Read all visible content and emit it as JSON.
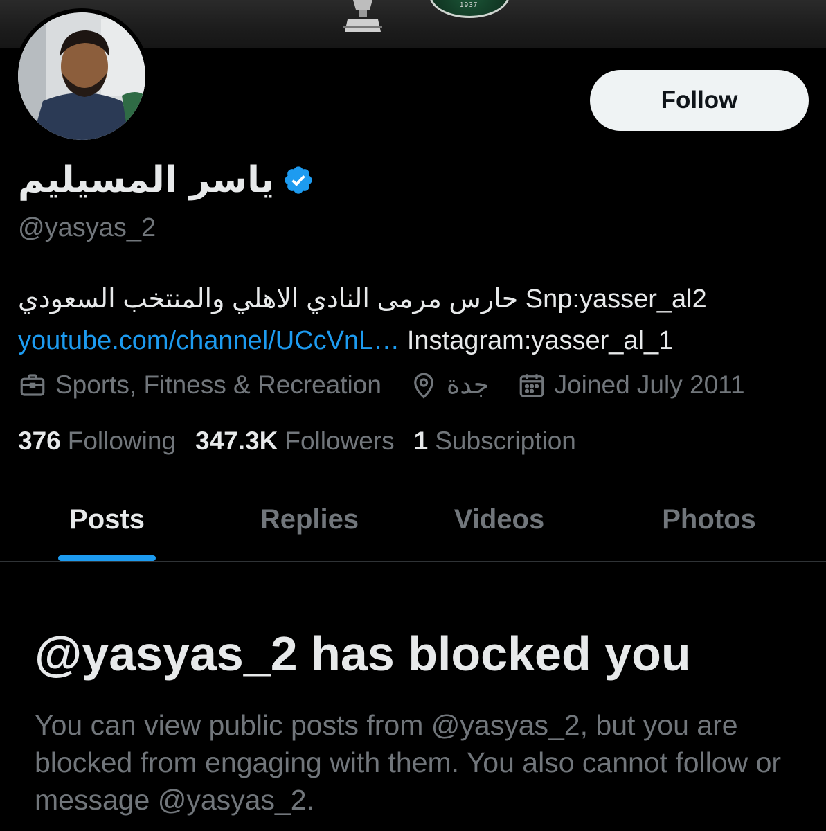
{
  "profile": {
    "display_name": "ياسر المسيليم",
    "handle": "@yasyas_2",
    "verified": true,
    "follow_label": "Follow",
    "bio_line1": "حارس مرمى النادي الاهلي والمنتخب السعودي Snp:yasser_al2",
    "bio_link": "youtube.com/channel/UCcVnL…",
    "bio_line2_rest": " Instagram:yasser_al_1",
    "category": "Sports, Fitness & Recreation",
    "location": "جدة",
    "joined": "Joined July 2011",
    "stats": {
      "following_count": "376",
      "following_label": "Following",
      "followers_count": "347.3K",
      "followers_label": "Followers",
      "subscriptions_count": "1",
      "subscriptions_label": "Subscription"
    }
  },
  "tabs": [
    {
      "label": "Posts",
      "active": true
    },
    {
      "label": "Replies",
      "active": false
    },
    {
      "label": "Videos",
      "active": false
    },
    {
      "label": "Photos",
      "active": false
    }
  ],
  "blocked": {
    "title": "@yasyas_2 has blocked you",
    "message": "You can view public posts from @yasyas_2, but you are blocked from engaging with them. You also cannot follow or message @yasyas_2."
  },
  "banner": {
    "crest_text": "1937"
  },
  "colors": {
    "accent": "#1d9bf0",
    "background": "#000000",
    "text_primary": "#e7e9ea",
    "text_secondary": "#71767b",
    "follow_button_bg": "#eff3f4"
  },
  "icons": {
    "verified": "verified-badge-icon",
    "category": "briefcase-icon",
    "location": "location-pin-icon",
    "joined": "calendar-icon"
  }
}
